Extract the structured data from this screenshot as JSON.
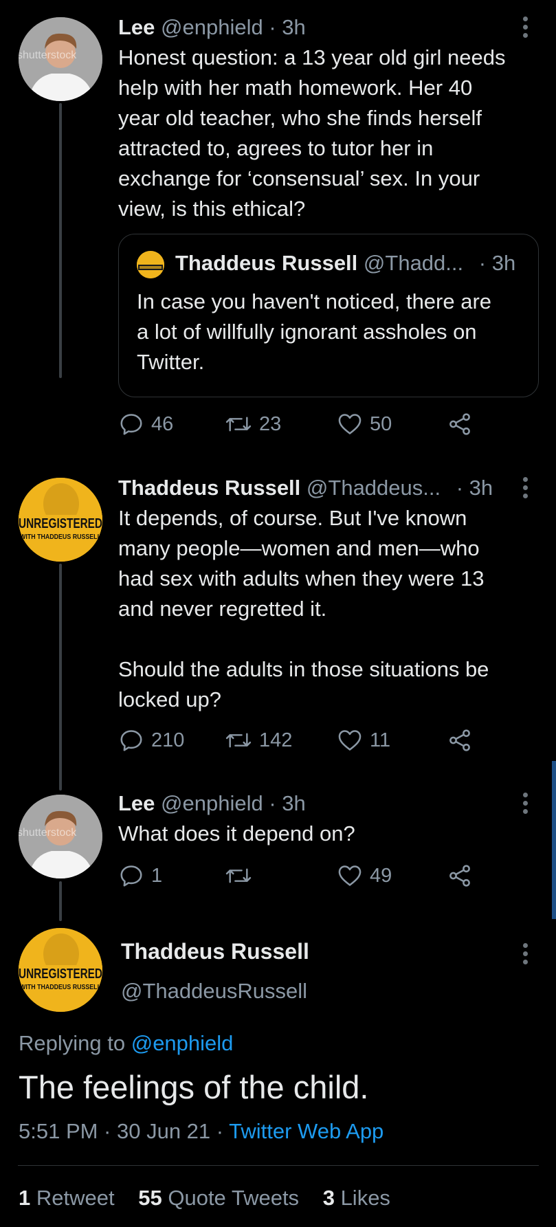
{
  "tweets": [
    {
      "author_name": "Lee",
      "handle": "@enphield",
      "time": "· 3h",
      "text": "Honest question: a 13 year old girl needs\nhelp with her math homework. Her 40\nyear old teacher, who she finds herself\nattracted to, agrees to tutor her in\nexchange for ‘consensual’ sex. In your\nview, is this ethical?",
      "avatar_watermark": "shutterstock",
      "quote": {
        "author_name": "Thaddeus Russell",
        "handle": "@Thadd...",
        "time": "· 3h",
        "text": "In case you haven't noticed, there are\na lot of willfully ignorant assholes on\nTwitter."
      },
      "replies": "46",
      "retweets": "23",
      "likes": "50"
    },
    {
      "author_name": "Thaddeus Russell",
      "handle": "@Thaddeus...",
      "time": "· 3h",
      "text": "It depends, of course. But I've known\nmany people—women and men—who\nhad sex with adults when they were 13\nand never regretted it.\n\nShould the adults in those situations be\nlocked up?",
      "replies": "210",
      "retweets": "142",
      "likes": "11"
    },
    {
      "author_name": "Lee",
      "handle": "@enphield",
      "time": "· 3h",
      "text": "What does it depend on?",
      "avatar_watermark": "shutterstock",
      "replies": "1",
      "retweets": "",
      "likes": "49"
    }
  ],
  "main_tweet": {
    "author_name": "Thaddeus Russell",
    "handle": "@ThaddeusRussell",
    "replying_to_label": "Replying to",
    "replying_to_handle": "@enphield",
    "text": "The feelings of the child.",
    "timestamp": "5:51 PM · 30 Jun 21 · ",
    "source": "Twitter Web App",
    "stats": {
      "retweets_count": "1",
      "retweets_label": "Retweet",
      "quotes_count": "55",
      "quotes_label": "Quote Tweets",
      "likes_count": "3",
      "likes_label": "Likes"
    }
  },
  "avatar_logo": {
    "title": "UNREGISTERED",
    "subtitle": "WITH THADDEUS RUSSELL"
  },
  "colors": {
    "background": "#000000",
    "text": "#e7e9ea",
    "muted": "#8b98a5",
    "link": "#1d9bf0",
    "logo_yellow": "#f0b41c",
    "scrollbar": "#1d4f86"
  }
}
